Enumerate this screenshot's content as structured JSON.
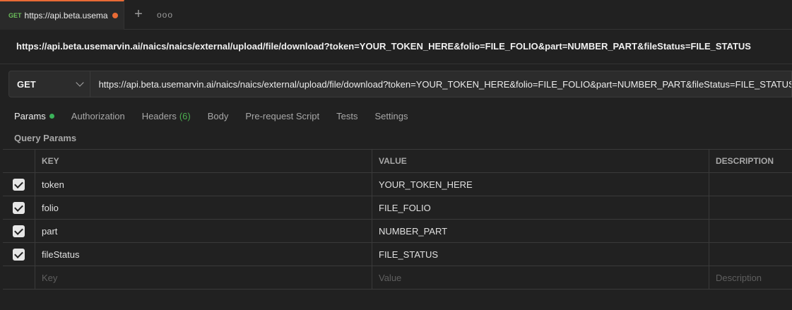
{
  "tab": {
    "method": "GET",
    "title": "https://api.beta.usema"
  },
  "tab_actions": {
    "add_label": "+",
    "more_label": "ooo"
  },
  "request": {
    "title": "https://api.beta.usemarvin.ai/naics/naics/external/upload/file/download?token=YOUR_TOKEN_HERE&folio=FILE_FOLIO&part=NUMBER_PART&fileStatus=FILE_STATUS",
    "method": "GET",
    "url": "https://api.beta.usemarvin.ai/naics/naics/external/upload/file/download?token=YOUR_TOKEN_HERE&folio=FILE_FOLIO&part=NUMBER_PART&fileStatus=FILE_STATUS"
  },
  "req_tabs": {
    "params": "Params",
    "authorization": "Authorization",
    "headers": "Headers",
    "headers_count": "(6)",
    "body": "Body",
    "prerequest": "Pre-request Script",
    "tests": "Tests",
    "settings": "Settings"
  },
  "query_params": {
    "title": "Query Params",
    "columns": {
      "key": "KEY",
      "value": "VALUE",
      "description": "DESCRIPTION"
    },
    "rows": [
      {
        "key": "token",
        "value": "YOUR_TOKEN_HERE",
        "description": ""
      },
      {
        "key": "folio",
        "value": "FILE_FOLIO",
        "description": ""
      },
      {
        "key": "part",
        "value": "NUMBER_PART",
        "description": ""
      },
      {
        "key": "fileStatus",
        "value": "FILE_STATUS",
        "description": ""
      }
    ],
    "placeholders": {
      "key": "Key",
      "value": "Value",
      "description": "Description"
    }
  },
  "colors": {
    "accent": "#e96b35",
    "get_method": "#6bbd5b",
    "status_dot": "#3bb25a",
    "background": "#212121"
  }
}
